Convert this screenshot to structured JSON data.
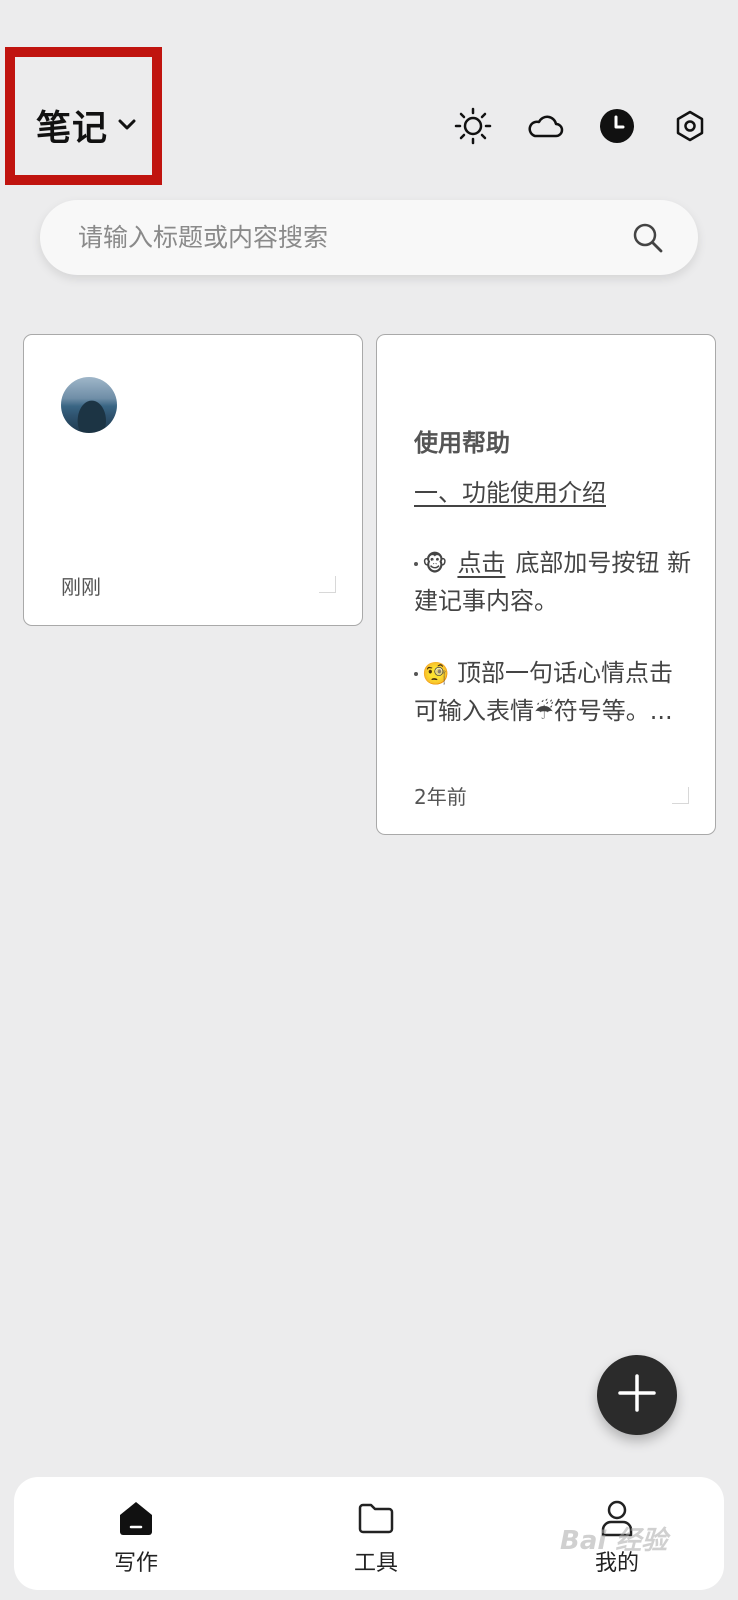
{
  "header": {
    "title": "笔记",
    "icons": [
      "sun-icon",
      "cloud-icon",
      "clock-icon",
      "settings-icon"
    ]
  },
  "search": {
    "placeholder": "请输入标题或内容搜索"
  },
  "notes": [
    {
      "image": "landscape-photo",
      "time": "刚刚"
    },
    {
      "title": "使用帮助",
      "link_text": "一、功能使用介绍",
      "para1_emoji": "🐵",
      "para1_link": "点击",
      "para1_text": "底部加号按钮 新建记事内容。",
      "para2_emoji": "🧐",
      "para2_text": "顶部一句话心情点击可输入表情",
      "para2_emoji2": "☔",
      "para2_text2": "符号等。...",
      "time": "2年前"
    }
  ],
  "fab": {
    "icon": "plus-icon"
  },
  "bottom_nav": [
    {
      "label": "写作",
      "icon": "write-icon"
    },
    {
      "label": "工具",
      "icon": "folder-icon"
    },
    {
      "label": "我的",
      "icon": "user-icon"
    }
  ],
  "watermark": "Bai 经验",
  "colors": {
    "highlight": "#c0140f",
    "background": "#ececed",
    "fab": "#2b2b2b"
  }
}
